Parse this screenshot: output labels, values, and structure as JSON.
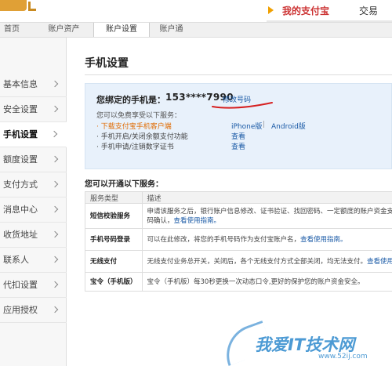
{
  "header": {
    "nav": [
      {
        "label": "我的支付宝",
        "active": true
      },
      {
        "label": "交易",
        "active": false
      }
    ]
  },
  "subnav": [
    {
      "label": "首页",
      "active": false
    },
    {
      "label": "账户资产",
      "active": false
    },
    {
      "label": "账户设置",
      "active": true
    },
    {
      "label": "账户通",
      "active": false
    }
  ],
  "sidebar": {
    "items": [
      {
        "label": "基本信息"
      },
      {
        "label": "安全设置"
      },
      {
        "label": "手机设置",
        "active": true
      },
      {
        "label": "额度设置"
      },
      {
        "label": "支付方式"
      },
      {
        "label": "消息中心"
      },
      {
        "label": "收货地址"
      },
      {
        "label": "联系人"
      },
      {
        "label": "代扣设置"
      },
      {
        "label": "应用授权"
      }
    ]
  },
  "main": {
    "title": "手机设置",
    "bound": {
      "label": "您绑定的手机是：",
      "number": "153****7990",
      "modify_link": "修改号码"
    },
    "free_intro": "您可以免费享受以下服务：",
    "services": [
      {
        "text": "· 下载支付宝手机客户端",
        "links": [
          "iPhone版",
          "Android版"
        ],
        "sep": "|"
      },
      {
        "text": "· 手机开启/关闭余额支付功能",
        "links": [
          "查看"
        ]
      },
      {
        "text": "· 手机申请/注销数字证书",
        "links": [
          "查看"
        ]
      }
    ],
    "open_heading": "您可以开通以下服务：",
    "table": {
      "headers": [
        "服务类型",
        "描述"
      ],
      "rows": [
        {
          "name": "短信校验服务",
          "desc1": "申请该服务之后，银行账户信息修改、证书验证、找回密码、一定额度的账户资金支",
          "desc2": "码确认，",
          "link": "查看使用指南。"
        },
        {
          "name": "手机号码登录",
          "desc1": "可以在此修改，将您的手机号码作为支付宝账户名，",
          "link": "查看使用指南。"
        },
        {
          "name": "无线支付",
          "desc1": "无线支付业务总开关，关闭后，各个无线支付方式全部关闭，均无法支付。",
          "link": "查看使用"
        },
        {
          "name": "宝令（手机版）",
          "desc1": "宝令（手机版）每30秒更换一次动态口令,更好的保护您的账户资金安全。"
        }
      ]
    }
  },
  "watermark": {
    "text": "我爱IT技术网",
    "domain": "www.52ij.com"
  },
  "colors": {
    "accent_blue": "#1a5aa6",
    "orange": "#e06a00",
    "active_red": "#cc3333",
    "annotation_red": "#d62020"
  }
}
